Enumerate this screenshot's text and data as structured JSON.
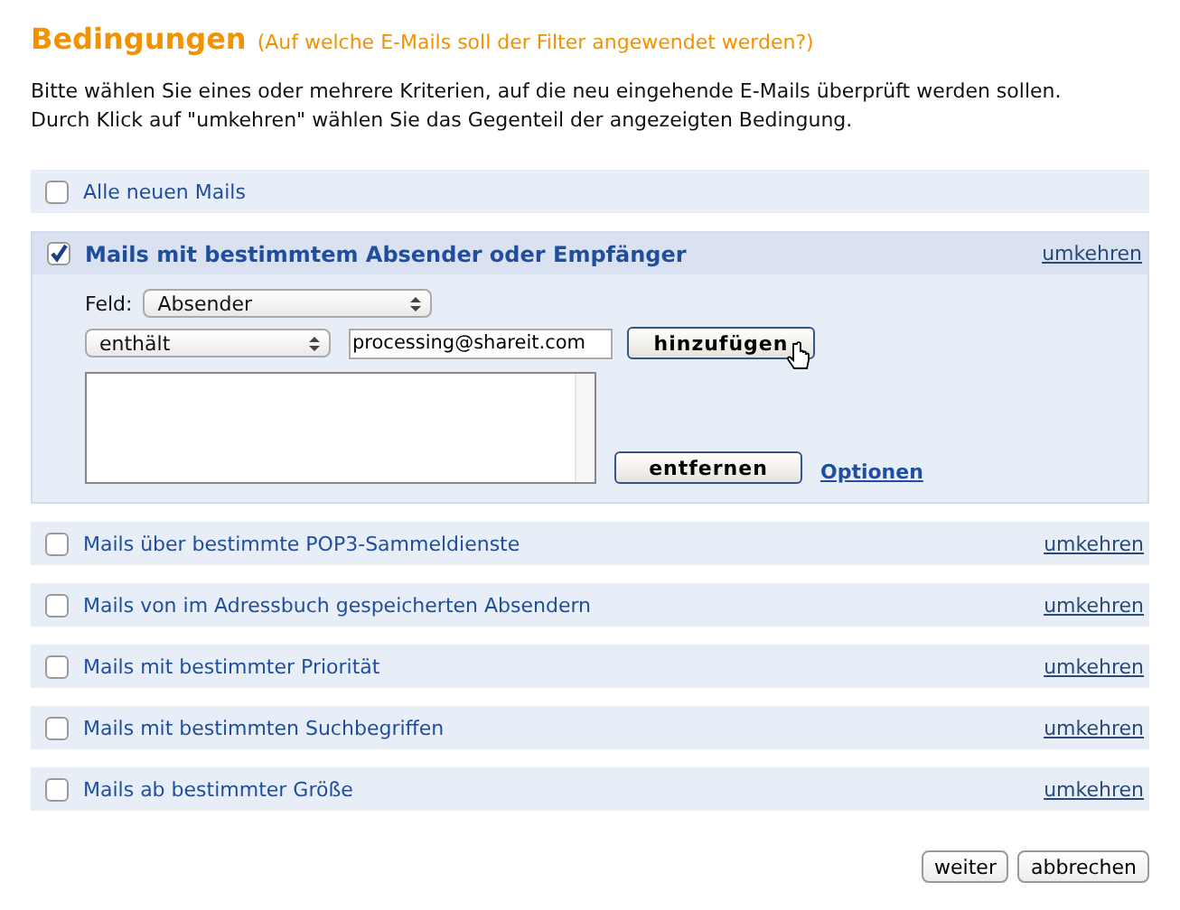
{
  "heading": {
    "title": "Bedingungen",
    "subtitle": "(Auf welche E-Mails soll der Filter angewendet werden?)"
  },
  "intro": [
    "Bitte wählen Sie eines oder mehrere Kriterien, auf die neu eingehende E-Mails überprüft werden sollen.",
    "Durch Klick auf \"umkehren\" wählen Sie das Gegenteil der angezeigten Bedingung."
  ],
  "conditions": [
    {
      "label": "Alle neuen Mails",
      "checked": false
    },
    {
      "label": "Mails mit bestimmtem Absender oder Empfänger",
      "checked": true,
      "invert_link": "umkehren",
      "details": {
        "field_label": "Feld:",
        "field_select": "Absender",
        "operator_select": "enthält",
        "value": "processing@shareit.com",
        "add_button": "hinzufügen",
        "remove_button": "entfernen",
        "options_link": "Optionen"
      }
    },
    {
      "label": "Mails über bestimmte POP3-Sammeldienste",
      "checked": false,
      "invert_link": "umkehren"
    },
    {
      "label": "Mails von im Adressbuch gespeicherten Absendern",
      "checked": false,
      "invert_link": "umkehren"
    },
    {
      "label": "Mails mit bestimmter Priorität",
      "checked": false,
      "invert_link": "umkehren"
    },
    {
      "label": "Mails mit bestimmten Suchbegriffen",
      "checked": false,
      "invert_link": "umkehren"
    },
    {
      "label": "Mails ab bestimmter Größe",
      "checked": false,
      "invert_link": "umkehren"
    }
  ],
  "buttons": [
    "weiter",
    "abbrechen"
  ]
}
